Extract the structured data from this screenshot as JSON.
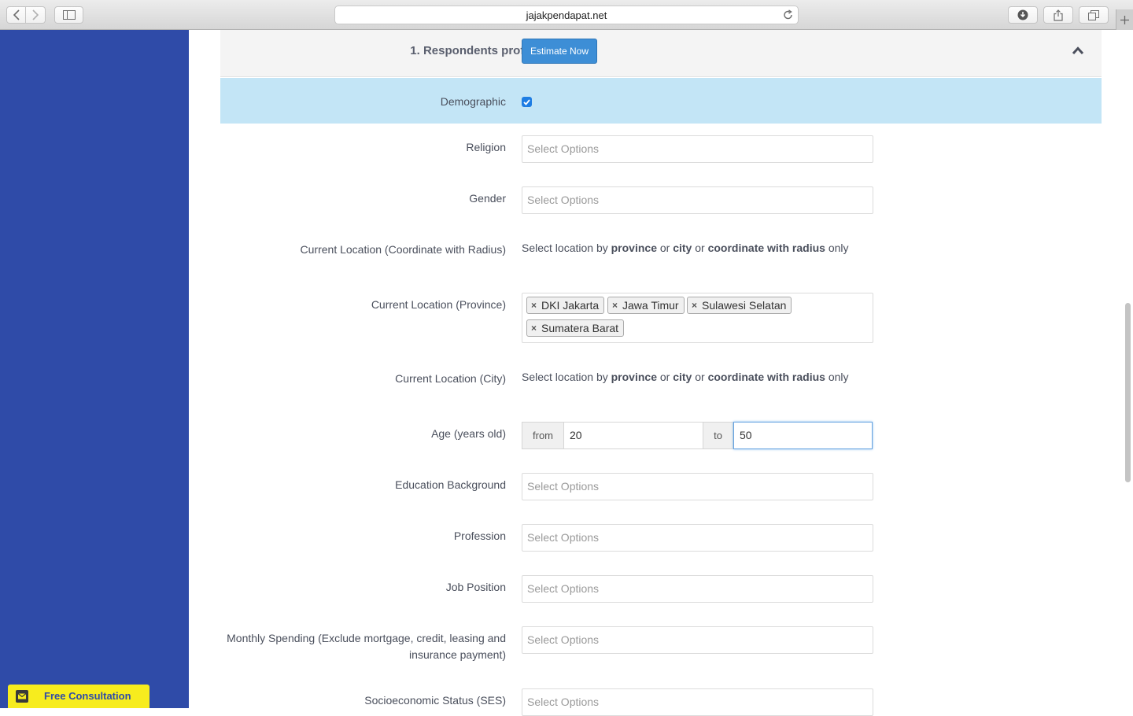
{
  "browser": {
    "url": "jajakpendapat.net"
  },
  "section": {
    "title": "1. Respondents profile",
    "estimate_button": "Estimate Now"
  },
  "demographic": {
    "label": "Demographic",
    "checked": true
  },
  "fields": {
    "religion": {
      "label": "Religion",
      "placeholder": "Select Options"
    },
    "gender": {
      "label": "Gender",
      "placeholder": "Select Options"
    },
    "coord": {
      "label": "Current Location (Coordinate with Radius)",
      "hint_prefix": "Select location by ",
      "hint_b1": "province",
      "hint_or1": " or ",
      "hint_b2": "city",
      "hint_or2": " or ",
      "hint_b3": "coordinate with radius",
      "hint_suffix": " only"
    },
    "province": {
      "label": "Current Location (Province)",
      "tags": [
        "DKI Jakarta",
        "Jawa Timur",
        "Sulawesi Selatan",
        "Sumatera Barat"
      ],
      "remove_glyph": "×"
    },
    "city": {
      "label": "Current Location (City)",
      "hint_prefix": "Select location by ",
      "hint_b1": "province",
      "hint_or1": " or ",
      "hint_b2": "city",
      "hint_or2": " or ",
      "hint_b3": "coordinate with radius",
      "hint_suffix": " only"
    },
    "age": {
      "label": "Age (years old)",
      "from_label": "from",
      "from_value": "20",
      "to_label": "to",
      "to_value": "50"
    },
    "education": {
      "label": "Education Background",
      "placeholder": "Select Options"
    },
    "profession": {
      "label": "Profession",
      "placeholder": "Select Options"
    },
    "job_position": {
      "label": "Job Position",
      "placeholder": "Select Options"
    },
    "spending": {
      "label_line1": "Monthly Spending (Exclude mortgage, credit, leasing and",
      "label_line2": "insurance payment)",
      "placeholder": "Select Options"
    },
    "ses": {
      "label": "Socioeconomic Status (SES)",
      "placeholder": "Select Options"
    }
  },
  "consultation": {
    "label": "Free Consultation"
  },
  "colors": {
    "sidebar": "#2f4ba8",
    "accent_button": "#3d8ed6",
    "demographic_row": "#c3e5f6",
    "consult_bg": "#f7ec1e"
  }
}
